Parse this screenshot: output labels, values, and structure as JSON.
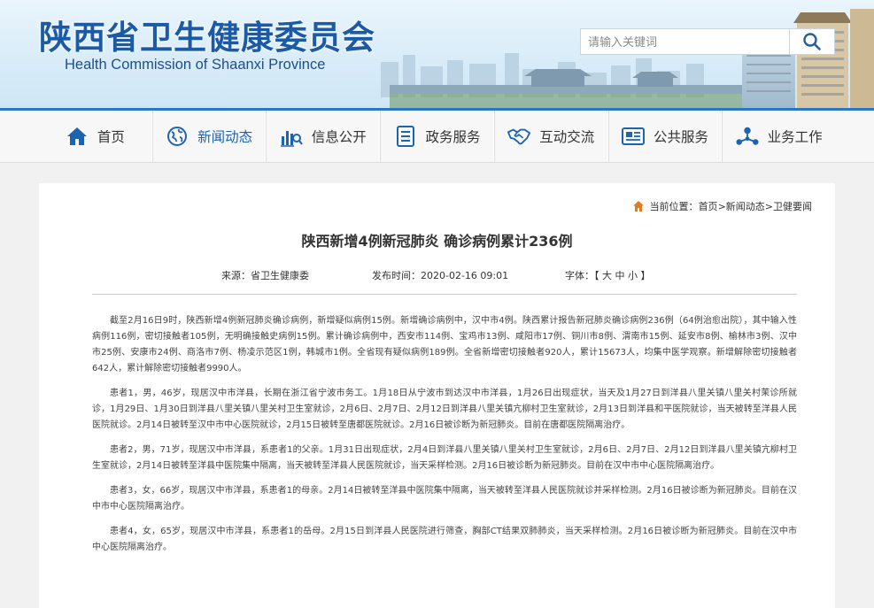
{
  "header": {
    "logo_cn": "陕西省卫生健康委员会",
    "logo_en": "Health Commission of Shaanxi Province",
    "search_placeholder": "请输入关键词",
    "search_icon": "magnifier-icon"
  },
  "colors": {
    "brand_blue": "#1a5aa6",
    "nav_active": "#1d63b2",
    "bar_blue": "#2a78c2",
    "accent_orange": "#e07b24"
  },
  "nav": [
    {
      "label": "首页",
      "icon": "home-icon"
    },
    {
      "label": "新闻动态",
      "icon": "globe-icon"
    },
    {
      "label": "信息公开",
      "icon": "chart-search-icon"
    },
    {
      "label": "政务服务",
      "icon": "document-icon"
    },
    {
      "label": "互动交流",
      "icon": "handshake-icon"
    },
    {
      "label": "公共服务",
      "icon": "newspaper-icon"
    },
    {
      "label": "业务工作",
      "icon": "network-icon"
    }
  ],
  "breadcrumb": {
    "prefix": "当前位置：",
    "items": [
      "首页",
      "新闻动态",
      "卫健要闻"
    ],
    "sep": ">"
  },
  "article": {
    "title": "陕西新增4例新冠肺炎 确诊病例累计236例",
    "source": "来源：省卫生健康委",
    "time": "发布时间：2020-02-16 09:01",
    "font": "字体：【 大 中 小 】",
    "paragraphs": [
      "截至2月16日9时，陕西新增4例新冠肺炎确诊病例，新增疑似病例15例。新增确诊病例中，汉中市4例。陕西累计报告新冠肺炎确诊病例236例（64例治愈出院），其中输入性病例116例，密切接触者105例，无明确接触史病例15例。累计确诊病例中，西安市114例、宝鸡市13例、咸阳市17例、铜川市8例、渭南市15例、延安市8例、榆林市3例、汉中市25例、安康市24例、商洛市7例、杨凌示范区1例，韩城市1例。全省现有疑似病例189例。全省新增密切接触者920人，累计15673人，均集中医学观察。新增解除密切接触者642人，累计解除密切接触者9990人。",
      "患者1，男，46岁，现居汉中市洋县，长期在浙江省宁波市务工。1月18日从宁波市到达汉中市洋县，1月26日出现症状，当天及1月27日到洋县八里关镇八里关村茉诊所就诊，1月29日、1月30日到洋县八里关镇八里关村卫生室就诊，2月6日、2月7日、2月12日到洋县八里关镇亢柳村卫生室就诊，2月13日到洋县和平医院就诊，当天被转至洋县人民医院就诊。2月14日被转至汉中市中心医院就诊，2月15日被转至唐都医院就诊。2月16日被诊断为新冠肺炎。目前在唐都医院隔离治疗。",
      "患者2，男，71岁，现居汉中市洋县，系患者1的父亲。1月31日出现症状，2月4日到洋县八里关镇八里关村卫生室就诊，2月6日、2月7日、2月12日到洋县八里关镇亢柳村卫生室就诊，2月14日被转至洋县中医院集中隔离，当天被转至洋县人民医院就诊，当天采样检测。2月16日被诊断为新冠肺炎。目前在汉中市中心医院隔离治疗。",
      "患者3，女，66岁，现居汉中市洋县，系患者1的母亲。2月14日被转至洋县中医院集中隔离，当天被转至洋县人民医院就诊并采样检测。2月16日被诊断为新冠肺炎。目前在汉中市中心医院隔离治疗。",
      "患者4，女，65岁，现居汉中市洋县，系患者1的岳母。2月15日到洋县人民医院进行筛查，胸部CT结果双肺肺炎，当天采样检测。2月16日被诊断为新冠肺炎。目前在汉中市中心医院隔离治疗。"
    ]
  }
}
